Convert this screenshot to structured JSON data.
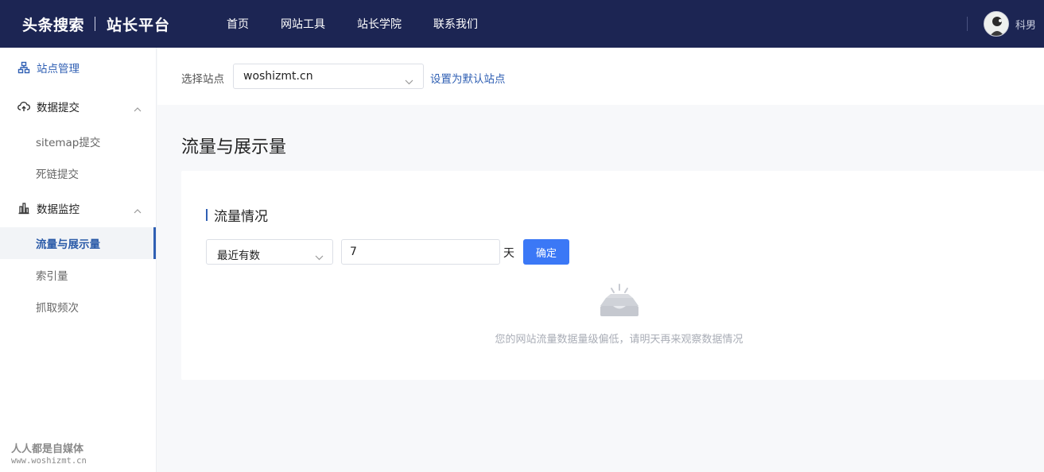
{
  "header": {
    "brand_primary": "头条搜索",
    "brand_secondary": "站长平台",
    "nav": [
      "首页",
      "网站工具",
      "站长学院",
      "联系我们"
    ],
    "username": "科男"
  },
  "sidebar": {
    "top_item": "站点管理",
    "groups": [
      {
        "label": "数据提交",
        "items": [
          "sitemap提交",
          "死链提交"
        ]
      },
      {
        "label": "数据监控",
        "items": [
          "流量与展示量",
          "索引量",
          "抓取频次"
        ]
      }
    ],
    "active_item": "流量与展示量"
  },
  "site_selector": {
    "label": "选择站点",
    "value": "woshizmt.cn",
    "set_default": "设置为默认站点"
  },
  "page": {
    "title": "流量与展示量",
    "section_title": "流量情况",
    "metric_select_value": "最近有数",
    "days_value": "7",
    "days_unit": "天",
    "confirm_label": "确定",
    "empty_message": "您的网站流量数据量级偏低，请明天再来观察数据情况"
  },
  "watermark": {
    "line1": "人人都是自媒体",
    "line2": "www.woshizmt.cn"
  },
  "colors": {
    "topbar": "#1c2553",
    "accent": "#2f5fb3",
    "button": "#3b78f6"
  }
}
